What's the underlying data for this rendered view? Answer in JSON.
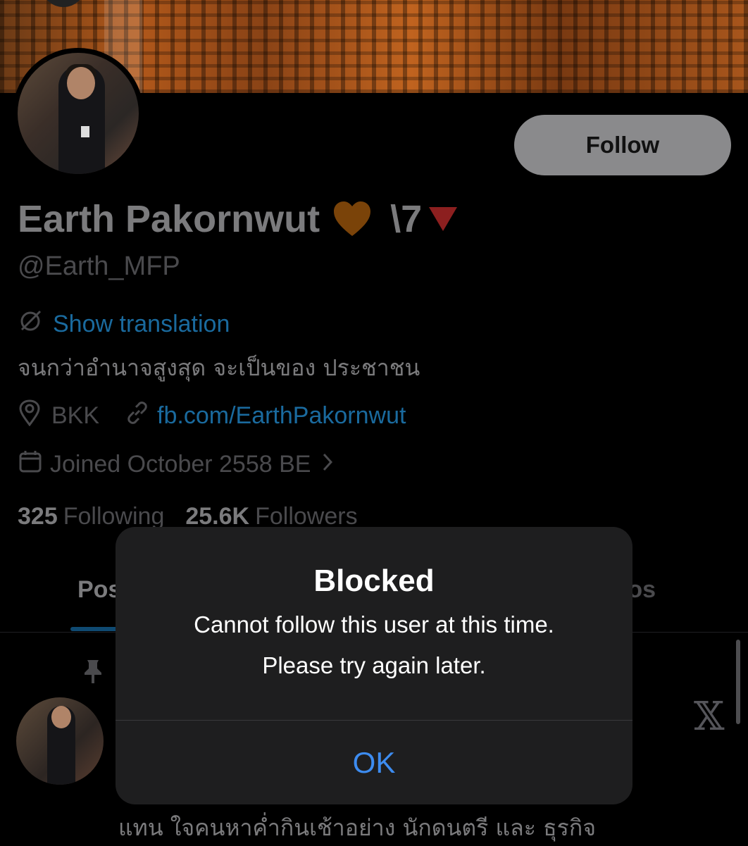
{
  "profile": {
    "follow_label": "Follow",
    "display_name": "Earth Pakornwut",
    "name_suffix": "\\7",
    "handle": "@Earth_MFP",
    "translate_label": "Show translation",
    "bio": "จนกว่าอำนาจสูงสุด จะเป็นของ ประชาชน",
    "location": "BKK",
    "link": "fb.com/EarthPakornwut",
    "joined": "Joined October 2558 BE",
    "following_count": "325",
    "following_label": "Following",
    "followers_count": "25.6K",
    "followers_label": "Followers"
  },
  "tabs": {
    "left_partial": "Pos",
    "right_partial": "tos"
  },
  "post": {
    "text_partial": "แทน ใจคนหาค่ำกินเช้าอย่าง นักดนตรี และ ธุรกิจ"
  },
  "dialog": {
    "title": "Blocked",
    "message_line1": "Cannot follow this user at this time.",
    "message_line2": "Please try again later.",
    "ok_label": "OK"
  },
  "icons": {
    "heart": "orange-heart-icon",
    "triangle": "red-triangle-down-icon",
    "translate": "translate-icon",
    "location": "location-pin-icon",
    "link": "link-icon",
    "calendar": "calendar-icon",
    "pin": "pinned-icon",
    "x_logo": "x-logo-icon"
  },
  "colors": {
    "link_blue": "#1a6a9e",
    "dialog_ok_blue": "#3d8cf0",
    "heart_orange": "#e07d10",
    "triangle_red": "#8c1f1f"
  }
}
